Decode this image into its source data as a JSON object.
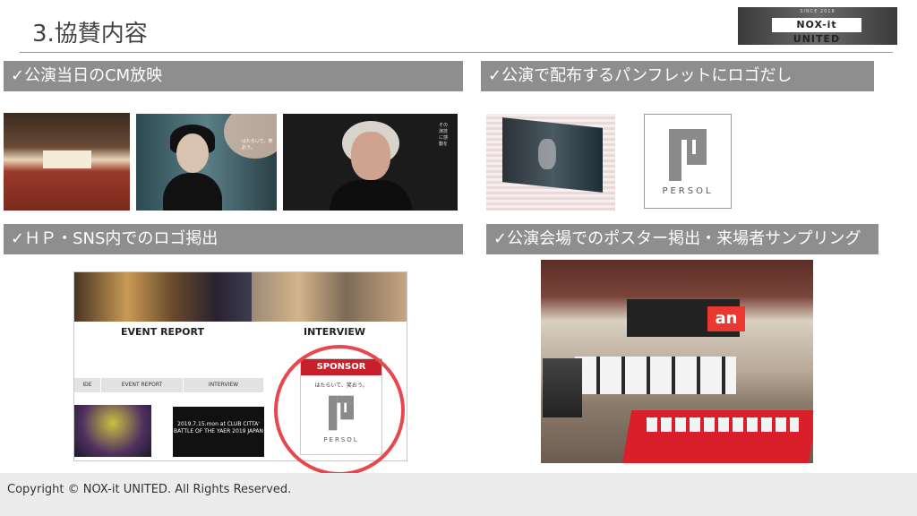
{
  "header": {
    "title": "3.協賛内容",
    "logo": {
      "tagline_top": "SINCE 2018",
      "name": "NOX-it UNITED",
      "tagline_bottom": ""
    }
  },
  "sections": {
    "cm": {
      "label": "✓公演当日のCM放映"
    },
    "pamphlet": {
      "label": "✓公演で配布するパンフレットにロゴだし"
    },
    "hp": {
      "label": "✓ＨＰ・SNS内でのロゴ掲出"
    },
    "poster": {
      "label": "✓公演会場でのポスター掲出・来場者サンプリング"
    }
  },
  "images": {
    "woman1_text": "はたらいて、笑おう。",
    "woman2_text": "その演技に感動を",
    "persol_word": "PERSOL"
  },
  "website": {
    "event_report": "EVENT REPORT",
    "interview": "INTERVIEW",
    "nav": [
      "IDE",
      "EVENT REPORT",
      "INTERVIEW"
    ],
    "battle_text": "2019.7.15.mon at CLUB CITTA' BATTLE OF THE YAER 2019 JAPAN",
    "sponsor_label": "SPONSOR",
    "sponsor_slogan": "はたらいて、笑おう。",
    "sponsor_word": "PERSOL"
  },
  "venue": {
    "an_logo": "an"
  },
  "footer": {
    "copyright": "Copyright © NOX-it UNITED. All Rights Reserved."
  },
  "colors": {
    "banner": "#8e8e8e",
    "accent_red": "#e8474f",
    "persol_gray": "#8a8a8a"
  }
}
